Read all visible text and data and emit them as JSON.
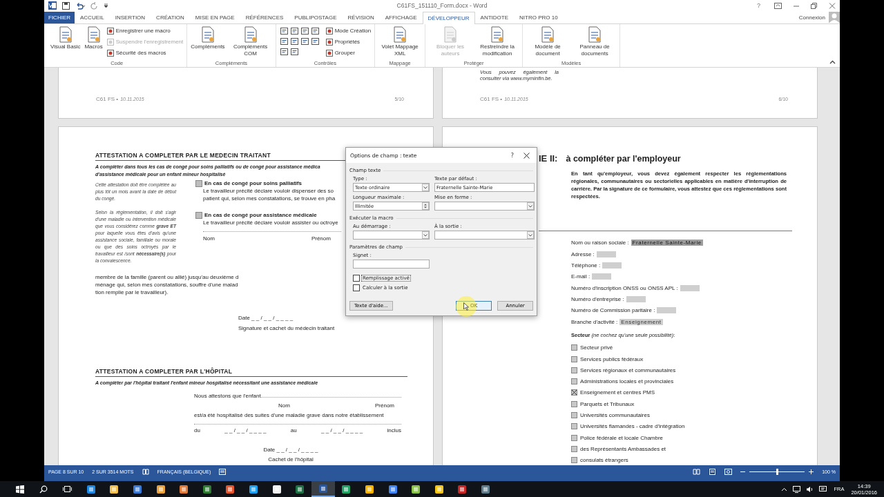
{
  "window": {
    "title": "C61FS_151110_Form.docx - Word",
    "help": "?",
    "account": "Connexion"
  },
  "tabs": [
    {
      "label": "FICHIER",
      "kind": "file",
      "selected": false
    },
    {
      "label": "ACCUEIL",
      "kind": "tab",
      "selected": false
    },
    {
      "label": "INSERTION",
      "kind": "tab",
      "selected": false
    },
    {
      "label": "CRÉATION",
      "kind": "tab",
      "selected": false
    },
    {
      "label": "MISE EN PAGE",
      "kind": "tab",
      "selected": false
    },
    {
      "label": "RÉFÉRENCES",
      "kind": "tab",
      "selected": false
    },
    {
      "label": "PUBLIPOSTAGE",
      "kind": "tab",
      "selected": false
    },
    {
      "label": "RÉVISION",
      "kind": "tab",
      "selected": false
    },
    {
      "label": "AFFICHAGE",
      "kind": "tab",
      "selected": false
    },
    {
      "label": "DÉVELOPPEUR",
      "kind": "tab",
      "selected": true
    },
    {
      "label": "ANTIDOTE",
      "kind": "tab",
      "selected": false
    },
    {
      "label": "NITRO PRO 10",
      "kind": "tab",
      "selected": false
    }
  ],
  "ribbon": {
    "groups": [
      {
        "label": "Code",
        "kind": "standard",
        "commands": [
          {
            "label": "Visual Basic",
            "kind": "large",
            "disabled": false
          },
          {
            "label": "Macros",
            "kind": "large",
            "disabled": false
          },
          {
            "label": "Enregistrer une macro",
            "kind": "small",
            "disabled": false
          },
          {
            "label": "Suspendre l'enregistrement",
            "kind": "small",
            "disabled": true
          },
          {
            "label": "Sécurité des macros",
            "kind": "small",
            "disabled": false
          }
        ]
      },
      {
        "label": "Compléments",
        "kind": "standard",
        "commands": [
          {
            "label": "Compléments",
            "kind": "large",
            "disabled": false
          },
          {
            "label": "Compléments COM",
            "kind": "large",
            "disabled": false
          }
        ]
      },
      {
        "label": "Contrôles",
        "kind": "controls",
        "commands": [
          {
            "label": "Mode Création",
            "kind": "small",
            "disabled": false
          },
          {
            "label": "Propriétés",
            "kind": "small",
            "disabled": false
          },
          {
            "label": "Grouper",
            "kind": "small",
            "disabled": false
          }
        ]
      },
      {
        "label": "Mappage",
        "kind": "standard",
        "commands": [
          {
            "label": "Volet Mappage XML",
            "kind": "large",
            "disabled": false
          }
        ]
      },
      {
        "label": "Protéger",
        "kind": "standard",
        "commands": [
          {
            "label": "Bloquer les auteurs",
            "kind": "large",
            "disabled": true
          },
          {
            "label": "Restreindre la modification",
            "kind": "large",
            "disabled": false
          }
        ]
      },
      {
        "label": "Modèles",
        "kind": "standard",
        "commands": [
          {
            "label": "Modèle de document",
            "kind": "large",
            "disabled": false
          },
          {
            "label": "Panneau de documents",
            "kind": "large",
            "disabled": false
          }
        ]
      }
    ]
  },
  "top_pages": [
    {
      "footer_code": "C61 FS •",
      "footer_date": "10.11.2015",
      "page_number": "5/10"
    },
    {
      "note": "Vous pouvez également la consulter via www.myminfin.be.",
      "footer_code": "C61 FS •",
      "footer_date": "10.11.2015",
      "page_number": "6/10"
    }
  ],
  "left_page": {
    "heading": "ATTESTATION A COMPLETER PAR LE MEDECIN TRAITANT",
    "intro_lines": [
      "A compléter dans tous les cas de congé pour soins palliatifs ou de congé pour assistance médica",
      "d'assistance médicale pour un enfant mineur hospitalisé"
    ],
    "side_notes": [
      "Cette attestation doit être complétée au plus tôt un mois avant la date de début du congé.",
      "Selon la réglementation, il doit s'agir d'une maladie ou intervention médicale que vous considérez comme **grave ET** pour laquelle vous êtes d'avis qu'une assistance sociale, familiale ou morale ou que des soins octroyés par le travailleur est /sont **nécessaire(s)** pour la convalescence."
    ],
    "options": [
      {
        "label": "En cas de congé pour soins palliatifs",
        "checked": false,
        "lines": [
          "Le travailleur précité déclare vouloir dispenser des so",
          "patient qui, selon mes constatations, se trouve en pha"
        ]
      },
      {
        "label": "En cas de congé pour assistance médicale",
        "checked": false,
        "lines": [
          "Le travailleur précité déclare vouloir assister ou octroye"
        ]
      }
    ],
    "name_labels": [
      "Nom",
      "Prénom"
    ],
    "family_lines": [
      "membre de la famille (parent ou allié) jusqu'au deuxième d",
      "ménage qui, selon mes constatations, souffre d'une malad",
      "tion remplie par le travailleur)."
    ],
    "date": "Date _ _ / _ _ / _ _ _ _",
    "signature": "Signature et cachet du médecin traitant",
    "heading2": "ATTESTATION A COMPLETER PAR L'HÔPITAL",
    "intro2": "A compléter par l'hôpital traitant l'enfant mineur hospitalisé nécessitant une assistance médicale",
    "statement": "Nous attestons que l'enfant",
    "name_labels2": [
      "Nom",
      "Prénom"
    ],
    "hospital_line": "est/a été hospitalisé des suites d'une maladie grave dans notre établissement",
    "period": [
      "du",
      "_ _ / _ _ / _ _ _ _",
      "au",
      "_ _ / _ _ / _ _ _ _",
      "inclus"
    ],
    "date2": "Date _ _ / _ _ / _ _ _ _",
    "stamp": "Cachet de l'hôpital"
  },
  "right_page": {
    "part": "IE II:",
    "title": "à compléter par l'employeur",
    "intro": "En tant qu'employeur, vous devez également respecter les réglementations régionales, communautaires ou sectorielles applicables en matière d'interruption de carrière. Par la signature de ce formulaire, vous attestez que ces réglementations sont respectées.",
    "fields": [
      {
        "label": "Nom ou raison sociale :",
        "value": "Fraternelle Sainte-Marie",
        "selected": true
      },
      {
        "label": "Adresse :",
        "selected": false
      },
      {
        "label": "Téléphone :",
        "selected": false
      },
      {
        "label": "E-mail :",
        "selected": false
      },
      {
        "label": "Numéro d'inscription ONSS ou ONSS APL :",
        "selected": false
      },
      {
        "label": "Numéro d'entreprise :",
        "selected": false
      },
      {
        "label": "Numéro de Commission paritaire :",
        "selected": false
      },
      {
        "label": "Branche d'activité :",
        "value": "Enseignement",
        "selected": false
      }
    ],
    "sector_label": "**Secteur** *(ne cochez qu'une seule possibilité)*:",
    "sectors": [
      {
        "label": "Secteur privé",
        "checked": false
      },
      {
        "label": "Services publics fédéraux",
        "checked": false
      },
      {
        "label": "Services régionaux et communautaires",
        "checked": false
      },
      {
        "label": "Administrations locales et provinciales",
        "checked": false
      },
      {
        "label": "Enseignement et centres PMS",
        "checked": true
      },
      {
        "label": "Parquets et Tribunaux",
        "checked": false
      },
      {
        "label": "Universités communautaires",
        "checked": false
      },
      {
        "label": "Universités flamandes - cadre d'intégration",
        "checked": false
      },
      {
        "label": "Police fédérale et locale Chambre",
        "checked": false
      },
      {
        "label": "des Représentants Ambassades et",
        "checked": false
      },
      {
        "label": "consulats étrangers",
        "checked": false
      }
    ]
  },
  "dialog": {
    "title": "Options de champ : texte",
    "help": "?",
    "sections": [
      {
        "title": "Champ texte",
        "fields": [
          {
            "label": "Type :",
            "kind": "dropdown",
            "value": "Texte ordinaire"
          },
          {
            "label": "Texte par défaut :",
            "kind": "text",
            "value": "Fraternelle Sainte-Marie"
          },
          {
            "label": "Longueur maximale :",
            "kind": "spinner",
            "value": "Illimitée"
          },
          {
            "label": "Mise en forme :",
            "kind": "dropdown"
          }
        ]
      },
      {
        "title": "Exécuter la macro",
        "fields": [
          {
            "label": "Au démarrage :",
            "kind": "dropdown"
          },
          {
            "label": "À la sortie :",
            "kind": "dropdown"
          }
        ]
      },
      {
        "title": "Paramètres de champ",
        "fields": [
          {
            "label": "Signet :",
            "kind": "text"
          }
        ]
      }
    ],
    "checkboxes": [
      {
        "label": "Remplissage activé",
        "checked": false,
        "focused": true
      },
      {
        "label": "Calculer à la sortie",
        "checked": false,
        "focused": false
      }
    ],
    "buttons": [
      {
        "label": "Texte d'aide...",
        "default": false
      },
      {
        "label": "OK",
        "default": true
      },
      {
        "label": "Annuler",
        "default": false
      }
    ]
  },
  "status_bar": {
    "page": "PAGE 8 SUR 10",
    "words": "2 SUR 3514 MOTS",
    "language": "FRANÇAIS (BELGIQUE)",
    "zoom": "100 %",
    "zoom_slider": {
      "level": 0.5
    }
  },
  "taskbar": {
    "language": "FRA",
    "time": "14:39",
    "date": "20/01/2016",
    "apps": [
      {
        "selected": false
      },
      {
        "selected": false
      },
      {
        "selected": false
      },
      {
        "selected": false
      },
      {
        "selected": false
      },
      {
        "selected": false
      },
      {
        "selected": false
      },
      {
        "selected": false
      },
      {
        "selected": false
      },
      {
        "selected": false
      },
      {
        "selected": true
      },
      {
        "selected": false
      },
      {
        "selected": false
      },
      {
        "selected": false
      },
      {
        "selected": false
      },
      {
        "selected": false
      },
      {
        "selected": false
      },
      {
        "selected": false
      }
    ]
  }
}
